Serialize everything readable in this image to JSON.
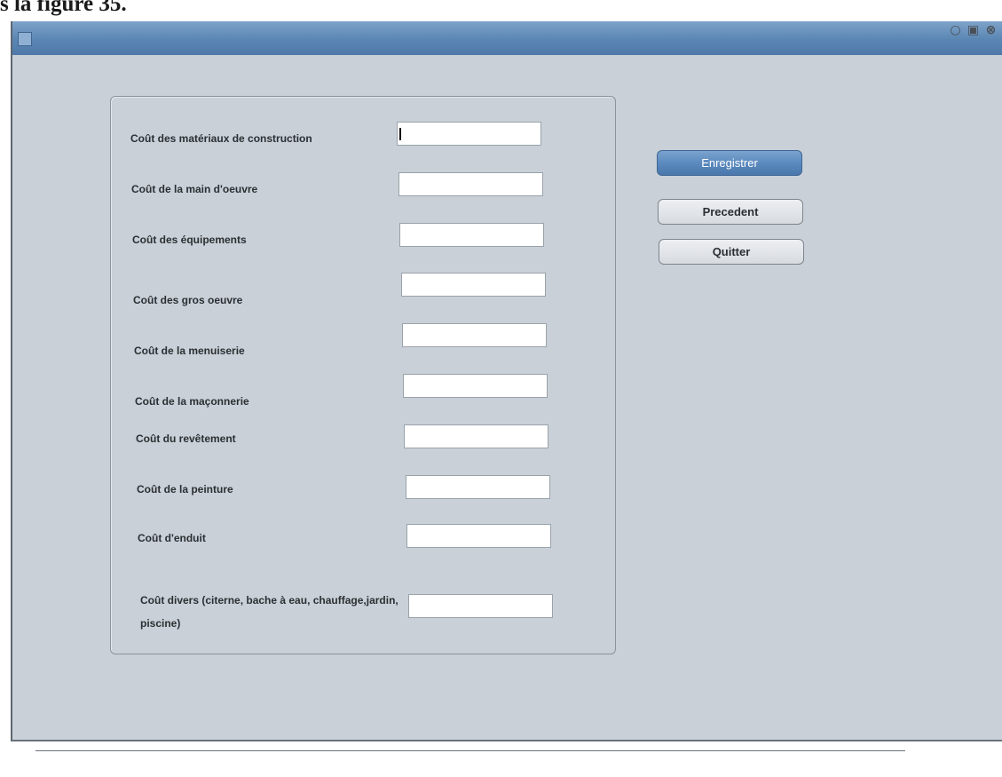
{
  "caption": "s la figure 35.",
  "window": {
    "controls": [
      "minimize-icon",
      "maximize-icon",
      "close-icon"
    ]
  },
  "form": {
    "fields": [
      {
        "label": "Coût des matériaux de construction",
        "value": ""
      },
      {
        "label": "Coût de la main d'oeuvre",
        "value": ""
      },
      {
        "label": "Coût des équipements",
        "value": ""
      },
      {
        "label": "Coût des gros oeuvre",
        "value": ""
      },
      {
        "label": "Coût de la menuiserie",
        "value": ""
      },
      {
        "label": "Coût de la maçonnerie",
        "value": ""
      },
      {
        "label": "Coût du revêtement",
        "value": ""
      },
      {
        "label": "Coût de la peinture",
        "value": ""
      },
      {
        "label": "Coût d'enduit",
        "value": ""
      },
      {
        "label": "Coût divers (citerne, bache à eau, chauffage,jardin, piscine)",
        "value": ""
      }
    ]
  },
  "actions": {
    "save_label": "Enregistrer",
    "previous_label": "Precedent",
    "quit_label": "Quitter"
  },
  "colors": {
    "window_bg": "#c9d0d7",
    "titlebar": "#5a86b4",
    "primary_button": "#5786bb"
  }
}
